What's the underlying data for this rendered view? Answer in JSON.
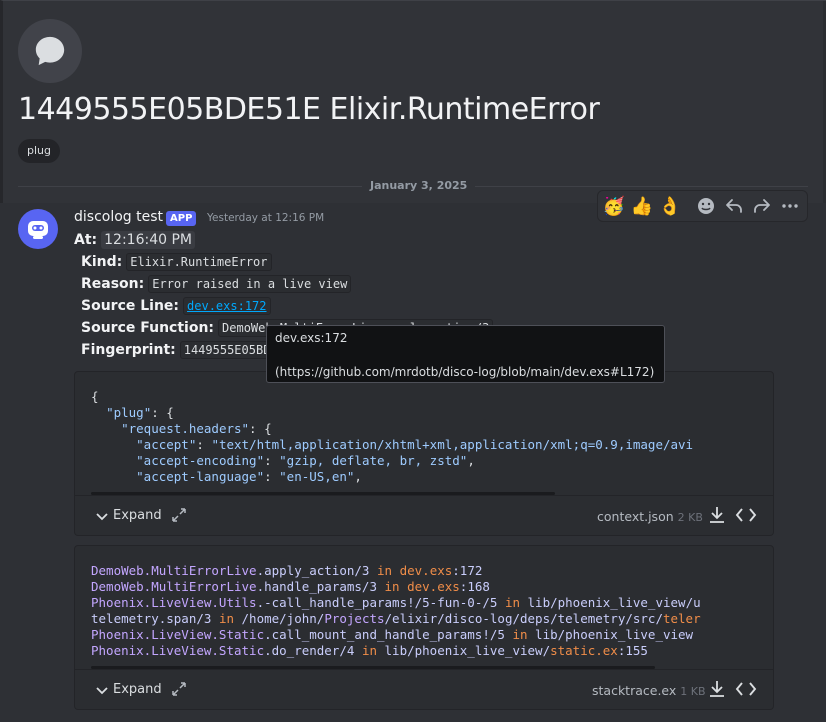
{
  "thread": {
    "title": "1449555E05BDE51E Elixir.RuntimeError",
    "tag": "plug",
    "icon": "chat-bubble-icon"
  },
  "divider": {
    "date": "January 3, 2025"
  },
  "message": {
    "author": "discolog test",
    "badge": "APP",
    "timestamp": "Yesterday at 12:16 PM",
    "fields": {
      "at_label": "At:",
      "at_value": "12:16:40 PM",
      "kind_label": "Kind:",
      "kind_value": "Elixir.RuntimeError",
      "reason_label": "Reason:",
      "reason_value": "Error raised in a live view",
      "source_line_label": "Source Line:",
      "source_line_value": "dev.exs:172",
      "source_function_label": "Source Function:",
      "source_function_value": "DemoWeb.MultiErrorLive.apply_action/3",
      "fingerprint_label": "Fingerprint:",
      "fingerprint_value": "1449555E05BDE51E"
    }
  },
  "actions": [
    "party-face-emoji",
    "thumbs-up-emoji",
    "ok-hand-emoji",
    "add-reaction-icon",
    "reply-icon",
    "forward-icon",
    "more-icon"
  ],
  "tooltip": {
    "line1": "dev.exs:172",
    "line2": "(https://github.com/mrdotb/disco-log/blob/main/dev.exs#L172)"
  },
  "attachments": [
    {
      "expand_label": "Expand",
      "filename": "context.json",
      "size": "2 KB"
    },
    {
      "expand_label": "Expand",
      "filename": "stacktrace.ex",
      "size": "1 KB"
    }
  ],
  "context_json": {
    "lines": [
      "{",
      "  \"plug\": {",
      "    \"request.headers\": {",
      "      \"accept\": \"text/html,application/xhtml+xml,application/xml;q=0.9,image/avi",
      "      \"accept-encoding\": \"gzip, deflate, br, zstd\",",
      "      \"accept-language\": \"en-US,en\","
    ]
  },
  "stacktrace": {
    "lines": [
      "DemoWeb.MultiErrorLive.apply_action/3 in dev.exs:172",
      "DemoWeb.MultiErrorLive.handle_params/3 in dev.exs:168",
      "Phoenix.LiveView.Utils.-call_handle_params!/5-fun-0-/5 in lib/phoenix_live_view/u",
      "telemetry.span/3 in /home/john/Projects/elixir/disco-log/deps/telemetry/src/teler",
      "Phoenix.LiveView.Static.call_mount_and_handle_params!/5 in lib/phoenix_live_view",
      "Phoenix.LiveView.Static.do_render/4 in lib/phoenix_live_view/static.ex:155"
    ]
  }
}
